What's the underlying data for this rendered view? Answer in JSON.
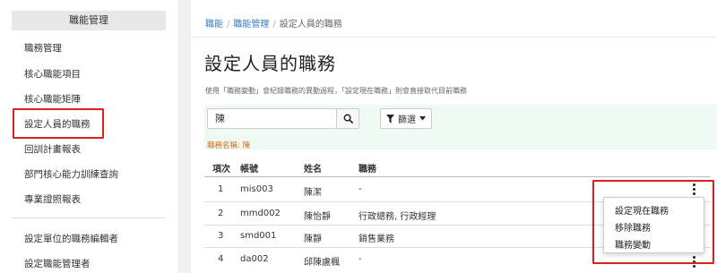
{
  "sidebar": {
    "header": "職能管理",
    "items": [
      {
        "label": "職務管理"
      },
      {
        "label": "核心職能項目"
      },
      {
        "label": "核心職能矩陣"
      },
      {
        "label": "設定人員的職務"
      },
      {
        "label": "回訓計畫報表"
      },
      {
        "label": "部門核心能力訓練查詢"
      },
      {
        "label": "專業證照報表"
      },
      {
        "label": "設定單位的職務編輯者"
      },
      {
        "label": "設定職能管理者"
      }
    ]
  },
  "breadcrumb": {
    "items": [
      "職能",
      "職能管理",
      "設定人員的職務"
    ]
  },
  "page": {
    "title": "設定人員的職務",
    "description": "使用「職務變動」會紀錄職務的異動過程，「設定現在職務」則會直接取代目前職務"
  },
  "search": {
    "value": "陳",
    "filter_label": "篩選"
  },
  "job_filter_tag": "職務名稱: 陳",
  "table": {
    "headers": [
      "項次",
      "帳號",
      "姓名",
      "職務"
    ],
    "rows": [
      {
        "index": "1",
        "account": "mis003",
        "name": "陳潔",
        "job": "-"
      },
      {
        "index": "2",
        "account": "mmd002",
        "name": "陳怡靜",
        "job": "行政總務, 行政經理"
      },
      {
        "index": "3",
        "account": "smd001",
        "name": "陳靜",
        "job": "銷售業務"
      },
      {
        "index": "4",
        "account": "da002",
        "name": "邱陳盧楓",
        "job": "-"
      }
    ]
  },
  "row_menu": {
    "items": [
      "設定現在職務",
      "移除職務",
      "職務變動"
    ]
  },
  "colors": {
    "highlight": "#e02020",
    "link": "#3a7cc6",
    "tag": "#d86a1a",
    "filter_bg": "#eef9f1"
  }
}
